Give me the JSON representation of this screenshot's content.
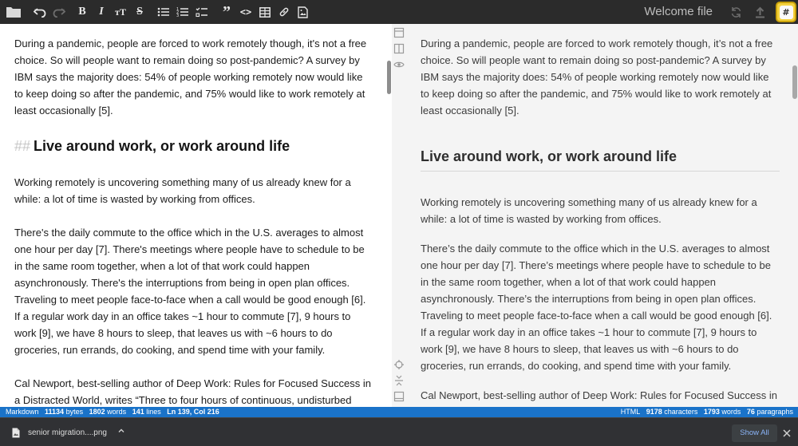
{
  "toolbar": {
    "buttons": [
      {
        "name": "folder",
        "label": ""
      },
      {
        "name": "undo",
        "label": ""
      },
      {
        "name": "redo",
        "label": ""
      },
      {
        "name": "bold",
        "label": "B"
      },
      {
        "name": "italic",
        "label": "I"
      },
      {
        "name": "heading",
        "label": "тT"
      },
      {
        "name": "strikethrough",
        "label": "S"
      },
      {
        "name": "bullet-list",
        "label": ""
      },
      {
        "name": "numbered-list",
        "label": ""
      },
      {
        "name": "task-list",
        "label": ""
      },
      {
        "name": "blockquote",
        "label": "”"
      },
      {
        "name": "code",
        "label": "<>"
      },
      {
        "name": "table",
        "label": ""
      },
      {
        "name": "link",
        "label": ""
      },
      {
        "name": "image",
        "label": ""
      }
    ],
    "document_title": "Welcome file",
    "theme_button_label": "#",
    "colors": {
      "background": "#2b2b2b",
      "accent": "#f5d33f"
    }
  },
  "editor": {
    "para1": "During a pandemic, people are forced to work remotely though, it's not a free choice. So will people want to remain doing so post-pandemic? A survey by IBM says the majority does: 54% of people working remotely now would like to keep doing so after the pandemic, and 75% would like to work remotely at least occasionally [5].",
    "heading_marker": "##",
    "heading": "Live around work, or work around life",
    "para2": "Working remotely is uncovering something many of us already knew for a while: a lot of time is wasted by working from offices.",
    "para3": "There's the daily commute to the office which in the U.S. averages to almost one hour per day [7]. There's meetings where people have to schedule to be in the same room together, when a lot of that work could happen asynchronously. There's the interruptions from being in open plan offices. Traveling to meet people face-to-face when a call would be good enough [6]. If a regular work day in an office takes ~1 hour to commute [7], 9 hours to work [9], we have 8 hours to sleep, that leaves us with ~6 hours to do groceries, run errands, do cooking, and spend time with your family.",
    "para4": "Cal Newport, best-selling author of Deep Work: Rules for Focused Success in a Distracted World, writes “Three to four hours of continuous, undisturbed deep"
  },
  "preview": {
    "para1": "During a pandemic, people are forced to work remotely though, it’s not a free choice. So will people want to remain doing so post-pandemic? A survey by IBM says the majority does: 54% of people working remotely now would like to keep doing so after the pandemic, and 75% would like to work remotely at least occasionally [5].",
    "heading": "Live around work, or work around life",
    "para2": "Working remotely is uncovering something many of us already knew for a while: a lot of time is wasted by working from offices.",
    "para3": "There’s the daily commute to the office which in the U.S. averages to almost one hour per day [7]. There’s meetings where people have to schedule to be in the same room together, when a lot of that work could happen asynchronously. There’s the interruptions from being in open plan offices. Traveling to meet people face-to-face when a call would be good enough [6]. If a regular work day in an office takes ~1 hour to commute [7], 9 hours to work [9], we have 8 hours to sleep, that leaves us with ~6 hours to do groceries, run errands, do cooking, and spend time with your family.",
    "para4": "Cal Newport, best-selling author of Deep Work: Rules for Focused Success in a"
  },
  "status_bar": {
    "mode": "Markdown",
    "bytes_value": "11134",
    "bytes_unit": "bytes",
    "words_value": "1802",
    "words_unit": "words",
    "lines_value": "141",
    "lines_unit": "lines",
    "cursor": "Ln 139, Col 216",
    "output": "HTML",
    "characters_value": "9178",
    "characters_unit": "characters",
    "preview_words_value": "1793",
    "preview_words_unit": "words",
    "paragraphs_value": "76",
    "paragraphs_unit": "paragraphs",
    "color": "#1a73c9"
  },
  "downloads": {
    "file_name": "senior migration....png",
    "show_all_label": "Show All"
  }
}
